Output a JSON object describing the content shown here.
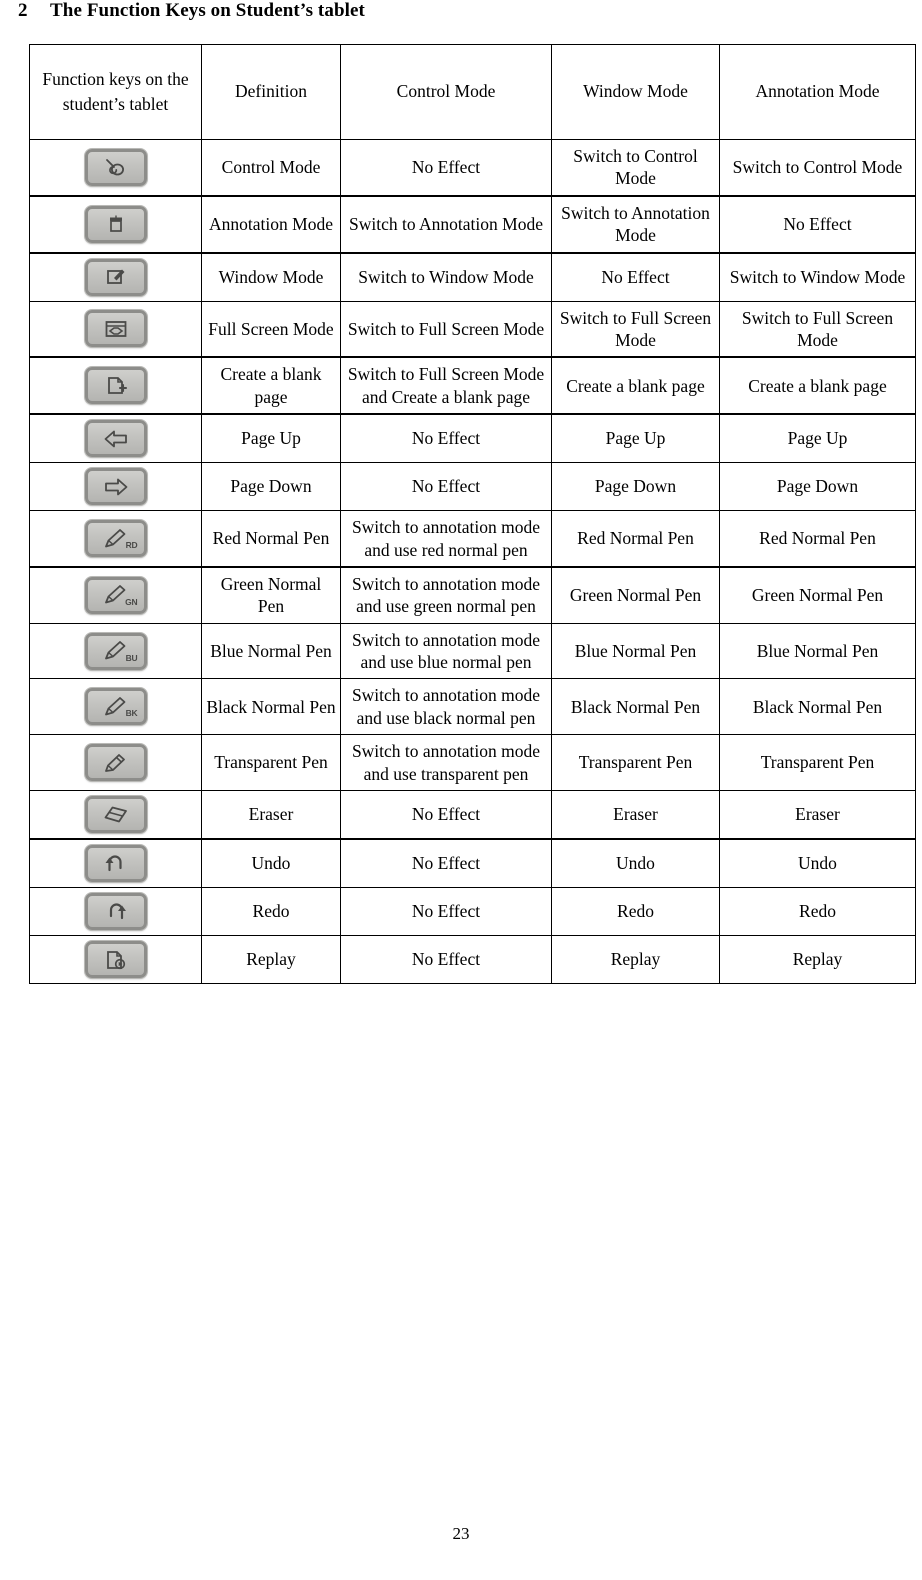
{
  "heading": {
    "number": "2",
    "title": "The Function Keys on Student’s tablet"
  },
  "table": {
    "headers": [
      "Function keys on the student’s tablet",
      "Definition",
      "Control Mode",
      "Window Mode",
      "Annotation Mode"
    ],
    "rows": [
      {
        "icon": "mouse-pointer-icon",
        "icon_tag": "",
        "definition": "Control Mode",
        "control_mode": "No Effect",
        "window_mode": "Switch to Control Mode",
        "annotation_mode": "Switch to Control Mode"
      },
      {
        "icon": "annotation-board-icon",
        "icon_tag": "",
        "definition": "Annotation Mode",
        "control_mode": "Switch to Annotation Mode",
        "window_mode": "Switch to Annotation Mode",
        "annotation_mode": "No Effect"
      },
      {
        "icon": "window-pen-icon",
        "icon_tag": "",
        "definition": "Window Mode",
        "control_mode": "Switch to Window Mode",
        "window_mode": "No Effect",
        "annotation_mode": "Switch to Window Mode"
      },
      {
        "icon": "full-screen-icon",
        "icon_tag": "",
        "definition": "Full Screen Mode",
        "control_mode": "Switch to Full Screen Mode",
        "window_mode": "Switch to Full Screen Mode",
        "annotation_mode": "Switch to Full Screen Mode"
      },
      {
        "icon": "new-page-icon",
        "icon_tag": "",
        "definition": "Create a blank page",
        "control_mode": "Switch to Full Screen Mode and Create a blank page",
        "window_mode": "Create a blank page",
        "annotation_mode": "Create a blank page"
      },
      {
        "icon": "arrow-left-icon",
        "icon_tag": "",
        "definition": "Page Up",
        "control_mode": "No Effect",
        "window_mode": "Page Up",
        "annotation_mode": "Page Up"
      },
      {
        "icon": "arrow-right-icon",
        "icon_tag": "",
        "definition": "Page Down",
        "control_mode": "No Effect",
        "window_mode": "Page Down",
        "annotation_mode": "Page Down"
      },
      {
        "icon": "pen-icon",
        "icon_tag": "RD",
        "definition": "Red Normal Pen",
        "control_mode": "Switch to annotation mode and use red normal pen",
        "window_mode": "Red Normal Pen",
        "annotation_mode": "Red Normal Pen"
      },
      {
        "icon": "pen-icon",
        "icon_tag": "GN",
        "definition": "Green Normal Pen",
        "control_mode": "Switch to annotation mode and use green normal pen",
        "window_mode": "Green Normal Pen",
        "annotation_mode": "Green Normal Pen"
      },
      {
        "icon": "pen-icon",
        "icon_tag": "BU",
        "definition": "Blue Normal Pen",
        "control_mode": "Switch to annotation mode and use blue normal pen",
        "window_mode": "Blue Normal Pen",
        "annotation_mode": "Blue Normal Pen"
      },
      {
        "icon": "pen-icon",
        "icon_tag": "BK",
        "definition": "Black Normal Pen",
        "control_mode": "Switch to annotation mode and use black normal pen",
        "window_mode": "Black Normal Pen",
        "annotation_mode": "Black Normal Pen"
      },
      {
        "icon": "transparent-pen-icon",
        "icon_tag": "",
        "definition": "Transparent Pen",
        "control_mode": "Switch to annotation mode and use transparent pen",
        "window_mode": "Transparent Pen",
        "annotation_mode": "Transparent Pen"
      },
      {
        "icon": "eraser-icon",
        "icon_tag": "",
        "definition": "Eraser",
        "control_mode": "No Effect",
        "window_mode": "Eraser",
        "annotation_mode": "Eraser"
      },
      {
        "icon": "undo-icon",
        "icon_tag": "",
        "definition": "Undo",
        "control_mode": "No Effect",
        "window_mode": "Undo",
        "annotation_mode": "Undo"
      },
      {
        "icon": "redo-icon",
        "icon_tag": "",
        "definition": "Redo",
        "control_mode": "No Effect",
        "window_mode": "Redo",
        "annotation_mode": "Redo"
      },
      {
        "icon": "replay-icon",
        "icon_tag": "",
        "definition": "Replay",
        "control_mode": "No Effect",
        "window_mode": "Replay",
        "annotation_mode": "Replay"
      }
    ]
  },
  "footer": {
    "page_number": "23"
  },
  "colors": {
    "text": "#000000",
    "background": "#ffffff",
    "rule": "#000000",
    "button_face": "#c6c6c3",
    "button_border": "#8d8d8a",
    "glyph": "#4a4a48"
  }
}
